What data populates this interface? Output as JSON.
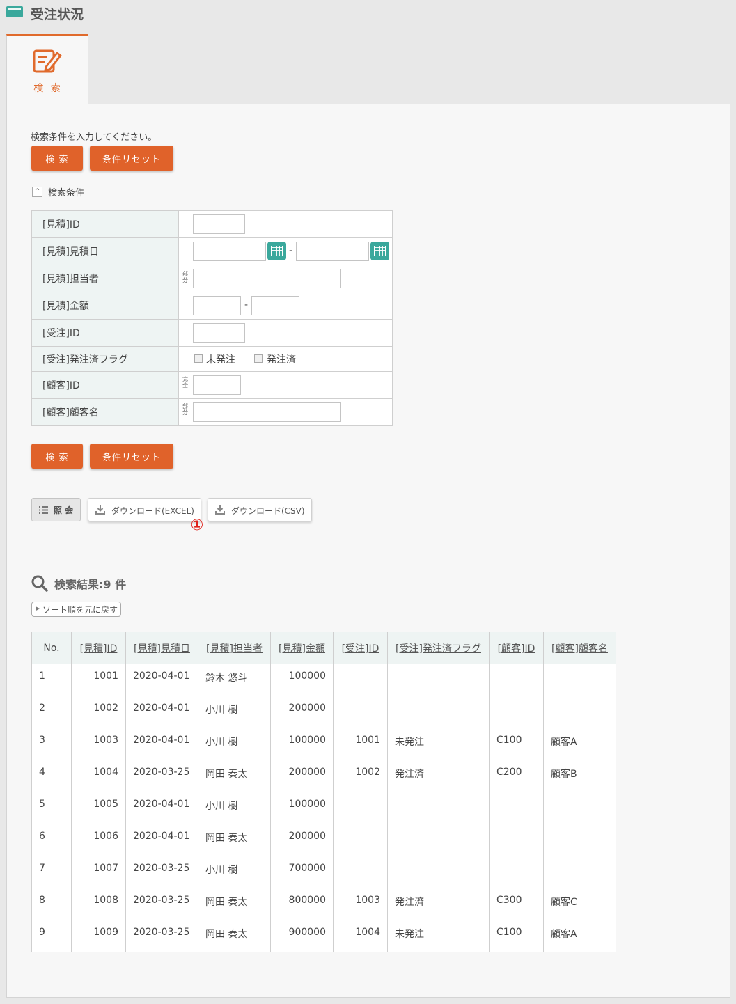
{
  "header": {
    "title": "受注状況"
  },
  "tab": {
    "label": "検 索"
  },
  "search": {
    "hint": "検索条件を入力してください。",
    "search_label": "検 索",
    "reset_label": "条件リセット",
    "section_label": "検索条件",
    "fields": [
      {
        "label": "[見積]ID"
      },
      {
        "label": "[見積]見積日"
      },
      {
        "label": "[見積]担当者",
        "match": "部分"
      },
      {
        "label": "[見積]金額"
      },
      {
        "label": "[受注]ID"
      },
      {
        "label": "[受注]発注済フラグ",
        "options": [
          "未発注",
          "発注済"
        ]
      },
      {
        "label": "[顧客]ID",
        "match": "完全"
      },
      {
        "label": "[顧客]顧客名",
        "match": "部分"
      }
    ],
    "range_separator": "-"
  },
  "toolbar": {
    "view_label": "照 会",
    "download_excel_label": "ダウンロード(EXCEL)",
    "download_csv_label": "ダウンロード(CSV)",
    "marker": "①"
  },
  "results": {
    "title": "検索結果:9 件",
    "sort_reset_label": "ソート順を元に戻す",
    "columns": [
      "No.",
      "[見積]ID",
      "[見積]見積日",
      "[見積]担当者",
      "[見積]金額",
      "[受注]ID",
      "[受注]発注済フラグ",
      "[顧客]ID",
      "[顧客]顧客名"
    ],
    "rows": [
      [
        "1",
        "1001",
        "2020-04-01",
        "鈴木 悠斗",
        "100000",
        "",
        "",
        "",
        ""
      ],
      [
        "2",
        "1002",
        "2020-04-01",
        "小川 樹",
        "200000",
        "",
        "",
        "",
        ""
      ],
      [
        "3",
        "1003",
        "2020-04-01",
        "小川 樹",
        "100000",
        "1001",
        "未発注",
        "C100",
        "顧客A"
      ],
      [
        "4",
        "1004",
        "2020-03-25",
        "岡田 奏太",
        "200000",
        "1002",
        "発注済",
        "C200",
        "顧客B"
      ],
      [
        "5",
        "1005",
        "2020-04-01",
        "小川 樹",
        "100000",
        "",
        "",
        "",
        ""
      ],
      [
        "6",
        "1006",
        "2020-04-01",
        "岡田 奏太",
        "200000",
        "",
        "",
        "",
        ""
      ],
      [
        "7",
        "1007",
        "2020-03-25",
        "小川 樹",
        "700000",
        "",
        "",
        "",
        ""
      ],
      [
        "8",
        "1008",
        "2020-03-25",
        "岡田 奏太",
        "800000",
        "1003",
        "発注済",
        "C300",
        "顧客C"
      ],
      [
        "9",
        "1009",
        "2020-03-25",
        "岡田 奏太",
        "900000",
        "1004",
        "未発注",
        "C100",
        "顧客A"
      ]
    ]
  },
  "colors": {
    "accent": "#e0622a",
    "teal": "#3aa89c",
    "marker": "#e0221b"
  }
}
